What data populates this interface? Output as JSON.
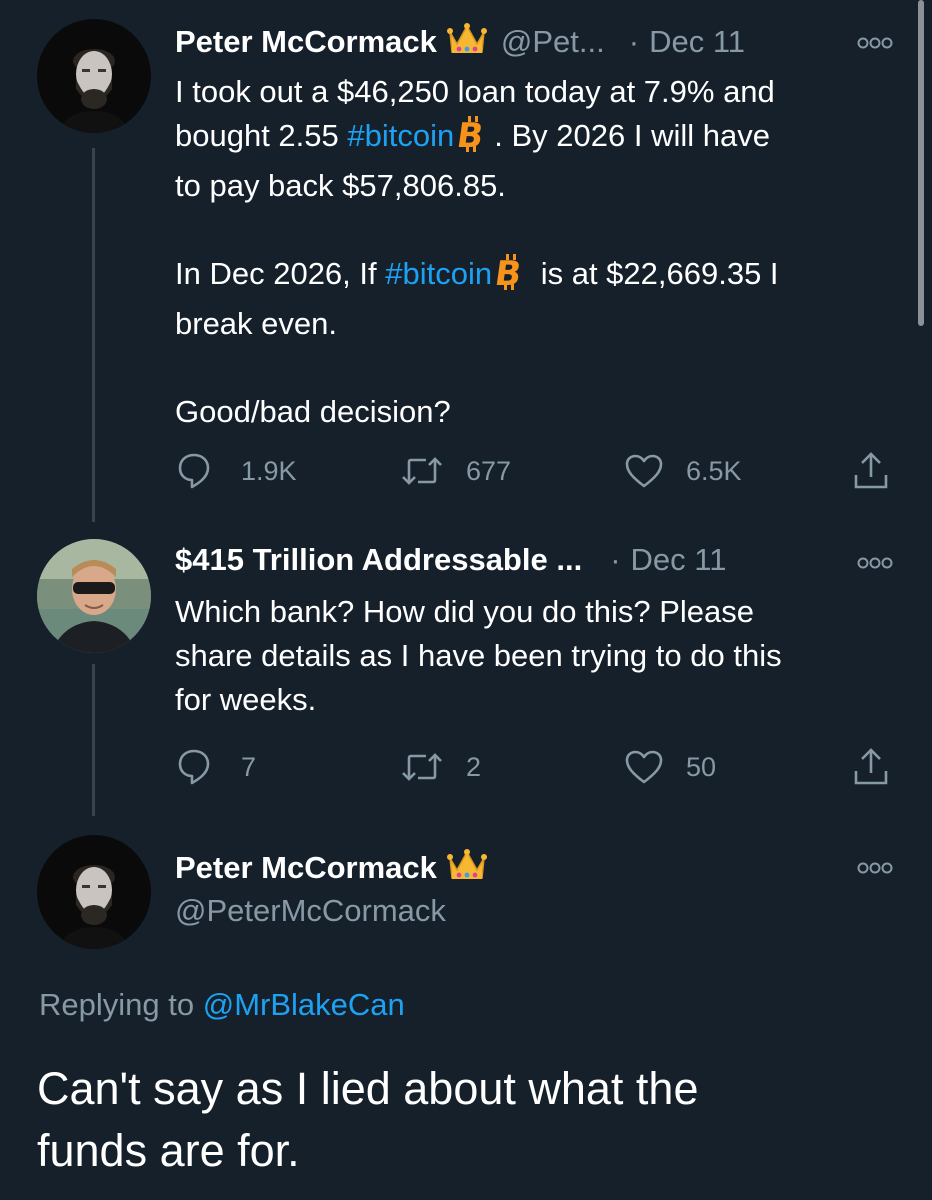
{
  "tweets": [
    {
      "name": "Peter McCormack",
      "handle": "@Pet...",
      "dot": "·",
      "date": "Dec 11",
      "text": {
        "l1": "I took out a $46,250 loan today at 7.9% and",
        "l2a": "bought 2.55 ",
        "l2tag": "#bitcoin",
        "l2b": ". By 2026 I will have",
        "l3": "to pay back $57,806.85.",
        "l4a": "In Dec 2026, If ",
        "l4tag": "#bitcoin",
        "l4b": " is at $22,669.35 I",
        "l5": "break even.",
        "l6": "Good/bad decision?"
      },
      "replies": "1.9K",
      "retweets": "677",
      "likes": "6.5K"
    },
    {
      "name": "$415 Trillion Addressable ...",
      "dot": "·",
      "date": "Dec 11",
      "text": {
        "l1": "Which bank? How did you do this? Please",
        "l2": "share details as I have been trying to do this",
        "l3": "for weeks."
      },
      "replies": "7",
      "retweets": "2",
      "likes": "50"
    },
    {
      "name": "Peter McCormack",
      "handle": "@PeterMcCormack",
      "replying_prefix": "Replying to",
      "replying_handle": "@MrBlakeCan",
      "text": {
        "l1": "Can't say as I lied about what the",
        "l2": "funds are for."
      }
    }
  ],
  "icons": [
    "crown-emoji",
    "bitcoin-emoji",
    "more-icon",
    "reply-icon",
    "retweet-icon",
    "like-icon",
    "share-icon"
  ],
  "colors": {
    "background": "#15202b",
    "link": "#1da1f2",
    "muted": "#8899a6",
    "bitcoin": "#f7931a"
  }
}
